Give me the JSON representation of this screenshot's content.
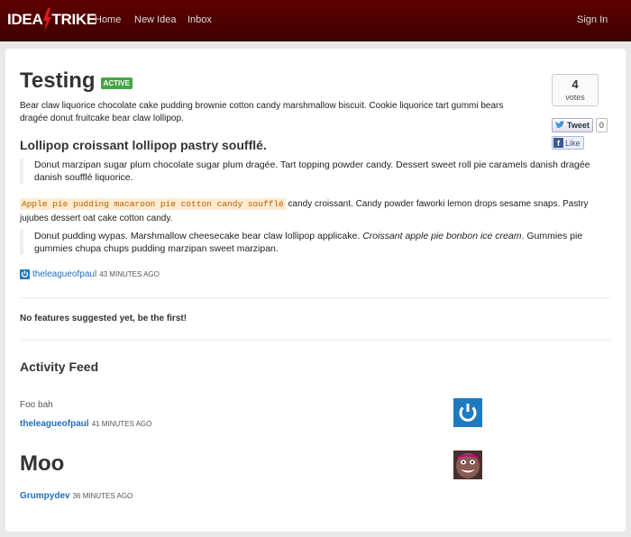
{
  "navbar": {
    "brand_left": "IDEA",
    "brand_right": "TRIKE",
    "home": "Home",
    "new_idea": "New Idea",
    "inbox": "Inbox",
    "sign_in": "Sign In",
    "bg_color": "#4a0000"
  },
  "idea": {
    "title": "Testing",
    "status": "ACTIVE",
    "description": "Bear claw liquorice chocolate cake pudding brownie cotton candy marshmallow biscuit. Cookie liquorice tart gummi bears dragée donut fruitcake bear claw lollipop.",
    "heading": "Lollipop croissant lollipop pastry soufflé.",
    "quote1": "Donut marzipan sugar plum chocolate sugar plum dragée. Tart topping powder candy. Dessert sweet roll pie caramels danish dragée danish soufflé liquorice.",
    "para_code": "Apple pie pudding macaroon pie cotton candy soufflé",
    "para_rest": " candy croissant. Candy powder faworki lemon drops sesame snaps. Pastry jujubes dessert oat cake cotton candy.",
    "quote2_a": "Donut pudding wypas. Marshmallow cheesecake bear claw lollipop applicake. ",
    "quote2_em": "Croissant apple pie bonbon ice cream",
    "quote2_b": ". Gummies pie gummies chupa chups pudding marzipan sweet marzipan.",
    "author": "theleagueofpaul",
    "time": "43 MINUTES AGO"
  },
  "votes": {
    "count": "4",
    "label": "votes"
  },
  "social": {
    "tweet": "Tweet",
    "tweet_count": "0",
    "like": "Like"
  },
  "features": {
    "empty": "No features suggested yet, be the first!"
  },
  "activity": {
    "heading": "Activity Feed",
    "items": [
      {
        "text": "Foo bah",
        "author": "theleagueofpaul",
        "time": "41 MINUTES AGO"
      },
      {
        "text": "Moo",
        "author": "Grumpydev",
        "time": "36 MINUTES AGO"
      }
    ]
  }
}
